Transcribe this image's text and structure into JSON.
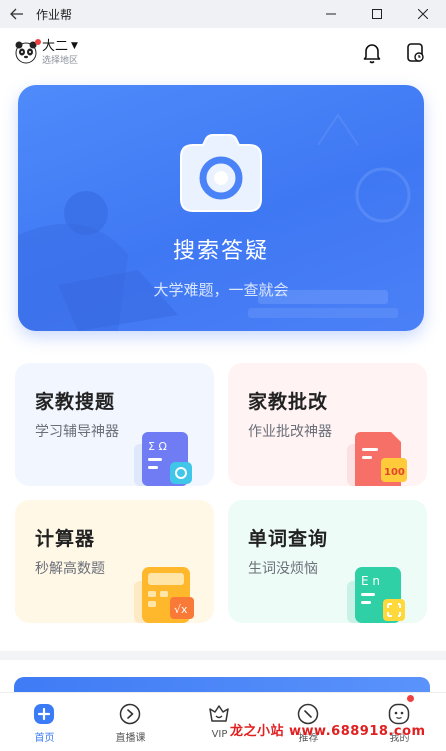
{
  "window": {
    "title": "作业帮"
  },
  "header": {
    "user_name": "大二",
    "region": "选择地区"
  },
  "hero": {
    "title": "搜索答疑",
    "subtitle": "大学难题，一查就会"
  },
  "cards": [
    {
      "title": "家教搜题",
      "subtitle": "学习辅导神器"
    },
    {
      "title": "家教批改",
      "subtitle": "作业批改神器"
    },
    {
      "title": "计算器",
      "subtitle": "秒解高数题"
    },
    {
      "title": "单词查询",
      "subtitle": "生词没烦恼"
    }
  ],
  "bottom_nav": [
    {
      "label": "首页",
      "active": true
    },
    {
      "label": "直播课"
    },
    {
      "label": "VIP"
    },
    {
      "label": "推荐"
    },
    {
      "label": "我的"
    }
  ],
  "watermark": "龙之小站 www.688918.com",
  "colors": {
    "accent": "#3b7bf6",
    "hero": "#3f78f3",
    "notification_dot": "#f04141"
  }
}
